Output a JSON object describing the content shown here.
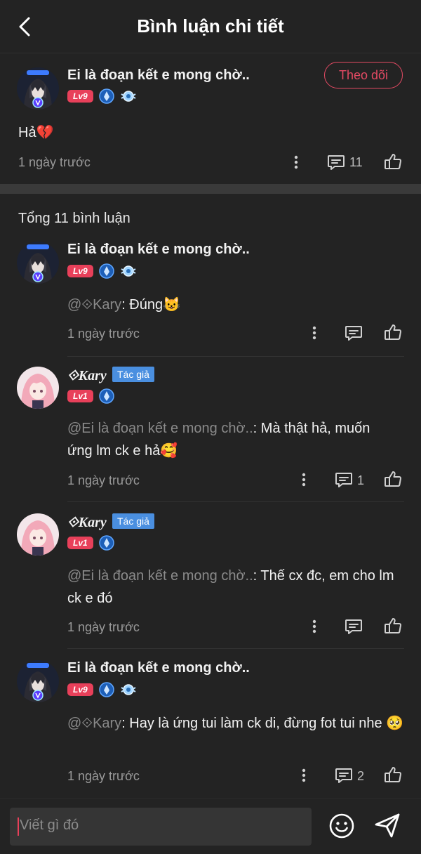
{
  "header": {
    "title": "Bình luận chi tiết"
  },
  "main_comment": {
    "username": "Ei là đoạn kết e mong chờ..",
    "level": "Lv9",
    "follow_label": "Theo dõi",
    "text": "Hả💔",
    "time": "1 ngày trước",
    "reply_count": "11"
  },
  "total_label": "Tổng 11 bình luận",
  "replies": [
    {
      "username": "Ei là đoạn kết e mong chờ..",
      "level": "Lv9",
      "mention": "@⟐Kary",
      "text": ": Đúng😺",
      "time": "1 ngày trước"
    },
    {
      "username": "⟐Kary",
      "author_tag": "Tác giả",
      "level": "Lv1",
      "mention": "@Ei là đoạn kết e mong chờ..",
      "text": ": Mà thật hả, muốn ứng lm ck e hả🥰",
      "time": "1 ngày trước",
      "reply_count": "1"
    },
    {
      "username": "⟐Kary",
      "author_tag": "Tác giả",
      "level": "Lv1",
      "mention": "@Ei là đoạn kết e mong chờ..",
      "text": ": Thế cx đc, em cho lm ck e đó",
      "time": "1 ngày trước"
    },
    {
      "username": "Ei là đoạn kết e mong chờ..",
      "level": "Lv9",
      "mention": "@⟐Kary",
      "text": ": Hay là ứng tui làm ck di, đừng fot tui nhe 🥺",
      "time": "1 ngày trước",
      "reply_count": "2"
    }
  ],
  "input": {
    "placeholder": "Viết gì đó"
  },
  "colors": {
    "accent": "#e8405a",
    "author_tag": "#4a8fe0",
    "background": "#232323"
  }
}
